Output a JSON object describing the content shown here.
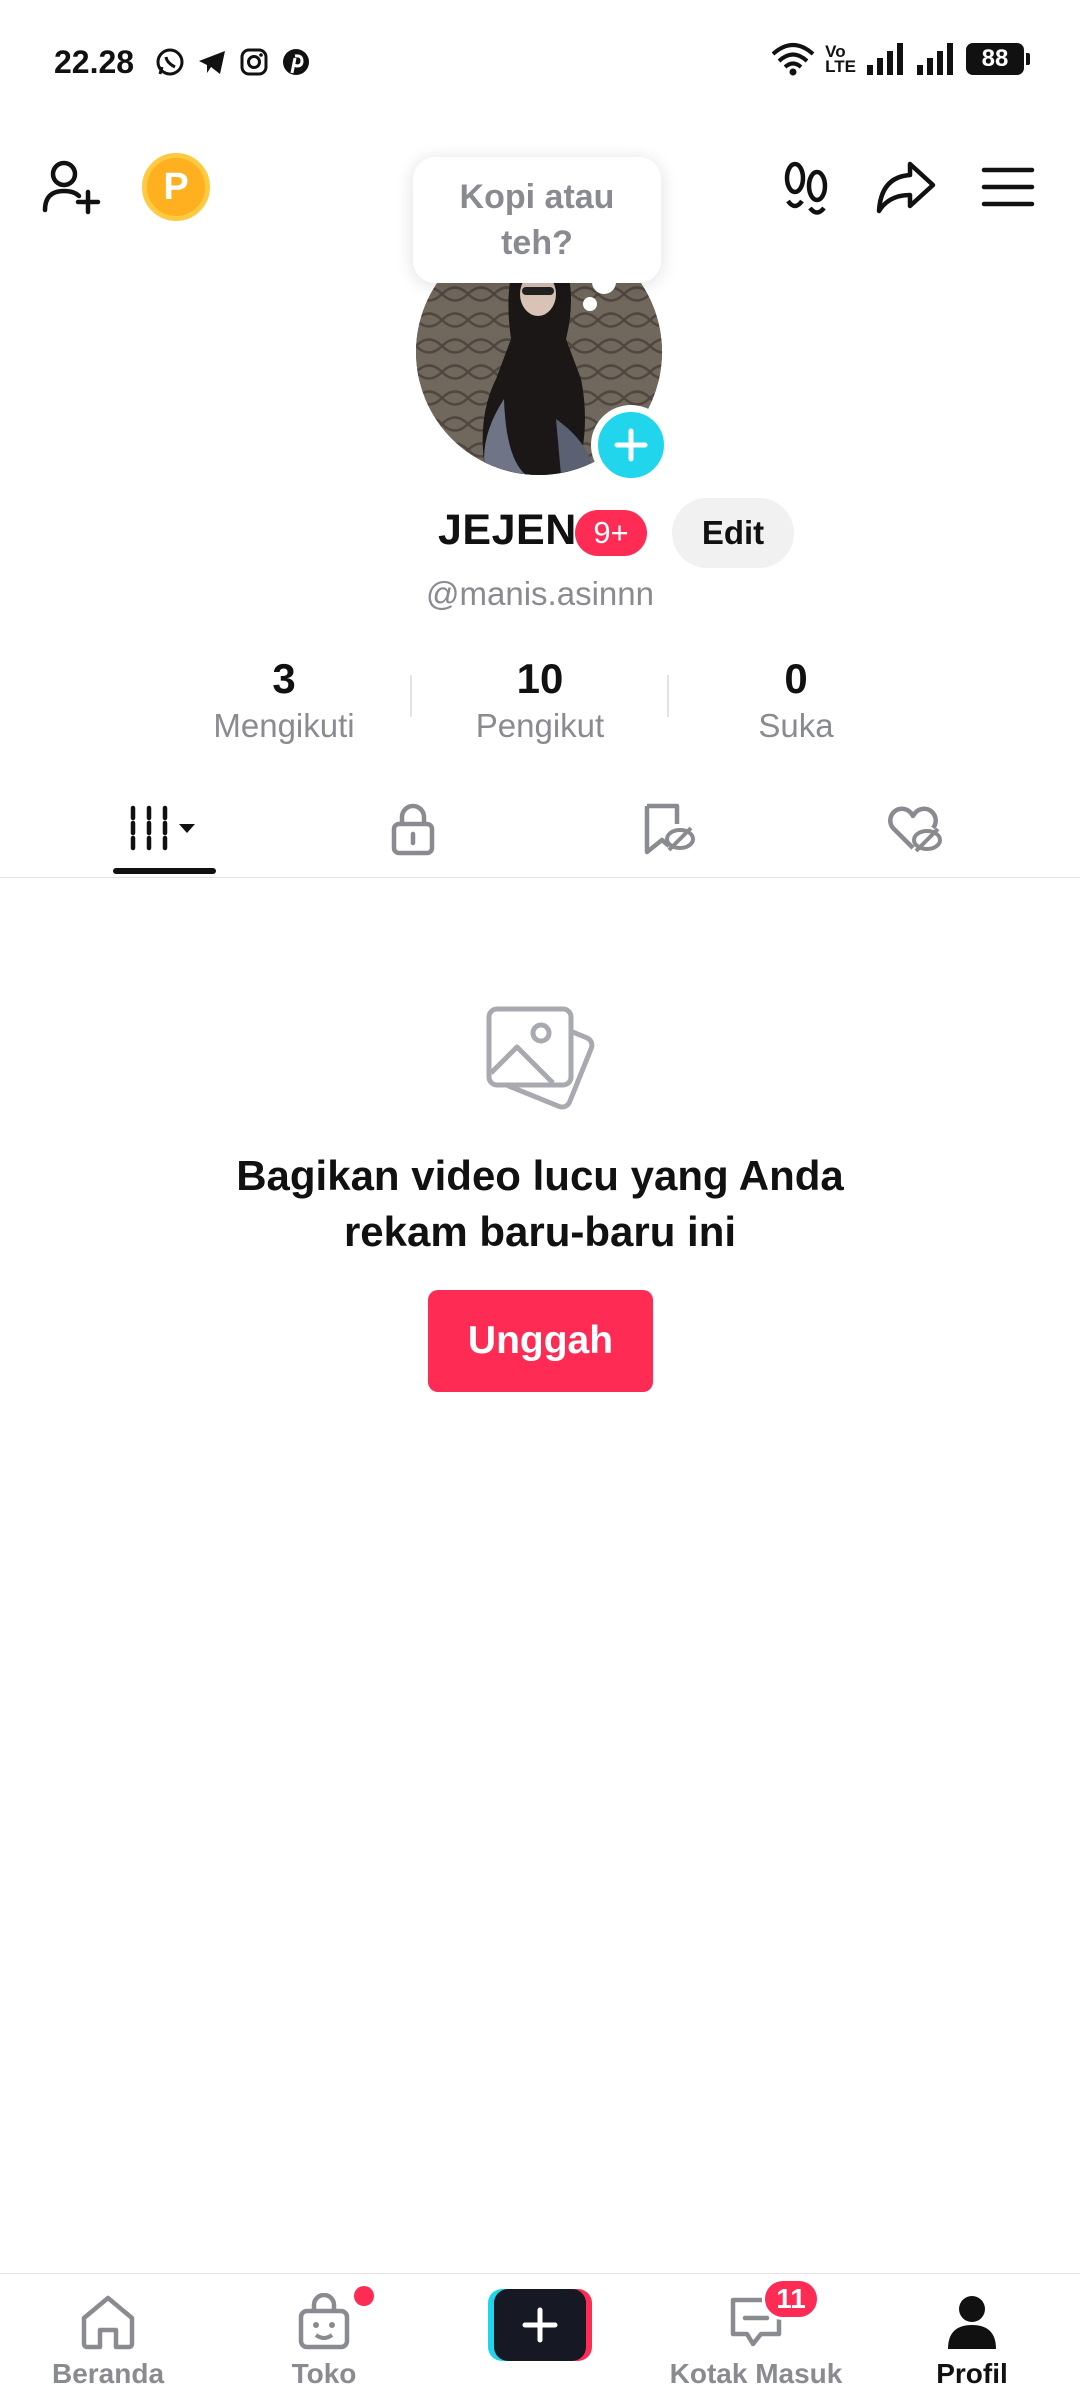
{
  "status_bar": {
    "time": "22.28",
    "apps": [
      "whatsapp-icon",
      "telegram-icon",
      "instagram-icon",
      "pinterest-icon"
    ],
    "volte_top": "Vo",
    "volte_bottom": "LTE",
    "battery": "88"
  },
  "header": {
    "coin_letter": "P"
  },
  "tooltip": {
    "line1": "Kopi atau",
    "line2": "teh?"
  },
  "profile": {
    "name": "JEJEN",
    "badge": "9+",
    "edit_label": "Edit",
    "handle": "@manis.asinnn"
  },
  "stats": [
    {
      "value": "3",
      "label": "Mengikuti"
    },
    {
      "value": "10",
      "label": "Pengikut"
    },
    {
      "value": "0",
      "label": "Suka"
    }
  ],
  "tabs": [
    "videos-grid-icon",
    "lock-icon",
    "hidden-repost-icon",
    "hidden-likes-icon"
  ],
  "empty_state": {
    "line1": "Bagikan video lucu yang Anda",
    "line2": "rekam baru-baru ini",
    "button": "Unggah"
  },
  "bottom_nav": {
    "items": [
      {
        "label": "Beranda",
        "icon": "home-icon"
      },
      {
        "label": "Toko",
        "icon": "shop-bag-icon"
      },
      {
        "label": "",
        "icon": "create-plus-icon"
      },
      {
        "label": "Kotak Masuk",
        "icon": "inbox-icon"
      },
      {
        "label": "Profil",
        "icon": "profile-icon"
      }
    ],
    "inbox_count": "11"
  },
  "colors": {
    "accent_red": "#fe2c55",
    "accent_cyan": "#20d5ec",
    "text_primary": "#161823",
    "text_secondary": "#8a8b91"
  }
}
